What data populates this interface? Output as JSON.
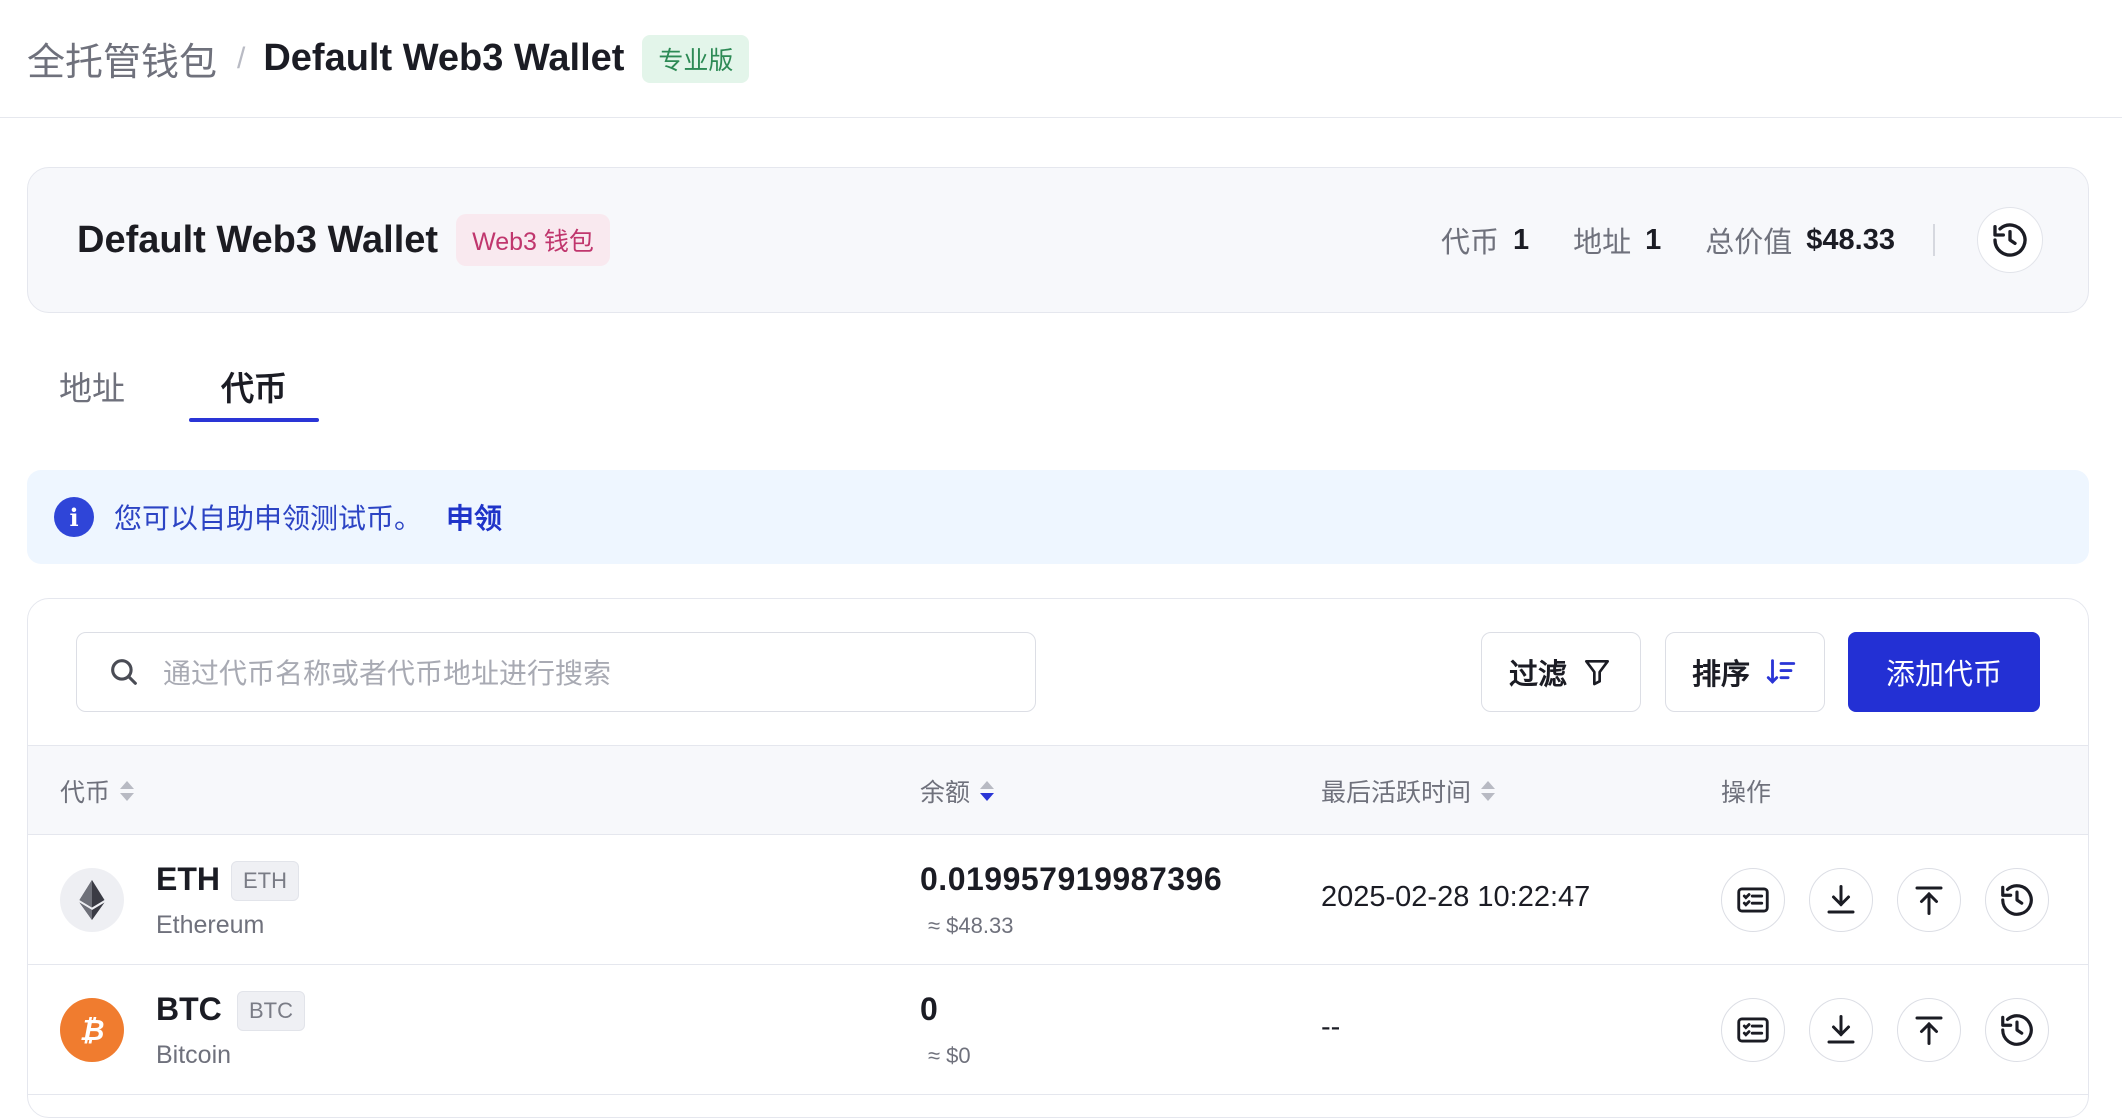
{
  "breadcrumb": {
    "parent": "全托管钱包",
    "separator": "/",
    "current": "Default Web3 Wallet",
    "badge": "专业版"
  },
  "summary": {
    "title": "Default Web3 Wallet",
    "badge": "Web3 钱包",
    "stats": [
      {
        "label": "代币",
        "value": "1"
      },
      {
        "label": "地址",
        "value": "1"
      },
      {
        "label": "总价值",
        "value": "$48.33"
      }
    ],
    "history_icon": "history-icon"
  },
  "tabs": [
    {
      "label": "地址",
      "active": false
    },
    {
      "label": "代币",
      "active": true
    }
  ],
  "notice": {
    "text": "您可以自助申领测试币。",
    "link": "申领",
    "icon": "info-icon"
  },
  "toolbar": {
    "search_placeholder": "通过代币名称或者代币地址进行搜索",
    "filter_label": "过滤",
    "sort_label": "排序",
    "add_label": "添加代币"
  },
  "table": {
    "columns": [
      "代币",
      "余额",
      "最后活跃时间",
      "操作"
    ],
    "rows": [
      {
        "symbol": "ETH",
        "chip": "ETH",
        "name": "Ethereum",
        "balance": "0.019957919987396",
        "balance_usd": "≈ $48.33",
        "last_active": "2025-02-28 10:22:47"
      },
      {
        "symbol": "BTC",
        "chip": "BTC",
        "name": "Bitcoin",
        "balance": "0",
        "balance_usd": "≈ $0",
        "last_active": "--"
      }
    ]
  },
  "colors": {
    "primary": "#2330d4",
    "pro_badge_bg": "#e3f5ea",
    "web3_badge_text": "#c0366d",
    "notice_bg": "#eef6ff",
    "btc": "#f07c2f"
  }
}
